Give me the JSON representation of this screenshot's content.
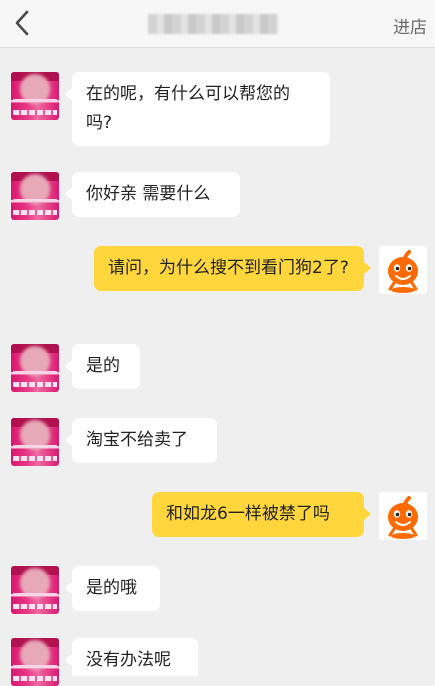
{
  "header": {
    "title": "",
    "enter_shop_label": "进店"
  },
  "messages": [
    {
      "side": "left",
      "text": "在的呢，有什么可以帮您的吗?"
    },
    {
      "side": "left",
      "text": "你好亲 需要什么"
    },
    {
      "side": "right",
      "text": "请问，为什么搜不到看门狗2了?"
    },
    {
      "side": "left",
      "text": "是的"
    },
    {
      "side": "left",
      "text": "淘宝不给卖了"
    },
    {
      "side": "right",
      "text": "和如龙6一样被禁了吗"
    },
    {
      "side": "left",
      "text": "是的哦"
    },
    {
      "side": "left",
      "text": "没有办法呢"
    }
  ],
  "icons": {
    "back": "chevron-left-icon",
    "bot_avatar": "orange-mascot-icon"
  },
  "colors": {
    "self_bubble": "#ffd73c",
    "other_bubble": "#ffffff",
    "background": "#efefef"
  }
}
